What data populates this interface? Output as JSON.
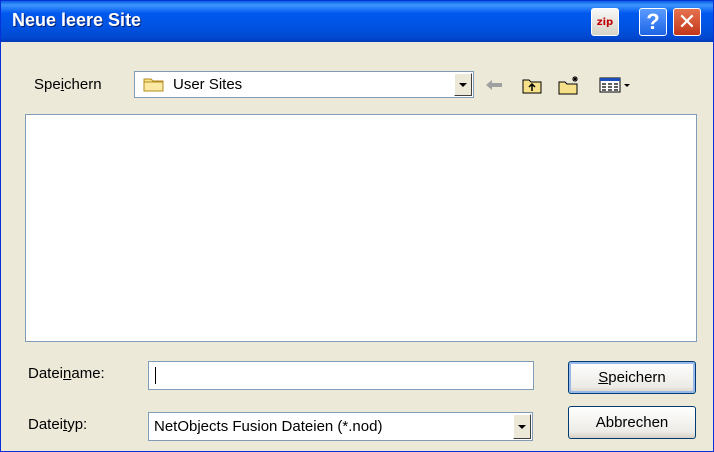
{
  "window": {
    "title": "Neue leere Site",
    "zip_label": "zip",
    "help_label": "?",
    "close_label": "✕"
  },
  "toolbar": {
    "savein_label_pre": "Spe",
    "savein_label_accel": "i",
    "savein_label_post": "chern",
    "savein_value": "User Sites",
    "icons": [
      "folder-icon",
      "back-arrow-icon",
      "up-folder-icon",
      "new-folder-icon",
      "view-menu-icon"
    ]
  },
  "form": {
    "filename_label_pre": "Datei",
    "filename_label_accel": "n",
    "filename_label_post": "ame:",
    "filename_value": "",
    "filetype_label_pre": "Datei",
    "filetype_label_accel": "t",
    "filetype_label_post": "yp:",
    "filetype_value": "NetObjects Fusion Dateien (*.nod)"
  },
  "buttons": {
    "save_accel": "S",
    "save_rest": "peichern",
    "cancel": "Abbrechen"
  },
  "colors": {
    "titlebar": "#0054e3",
    "dialog_bg": "#ece9d8",
    "field_border": "#7f9db9"
  }
}
